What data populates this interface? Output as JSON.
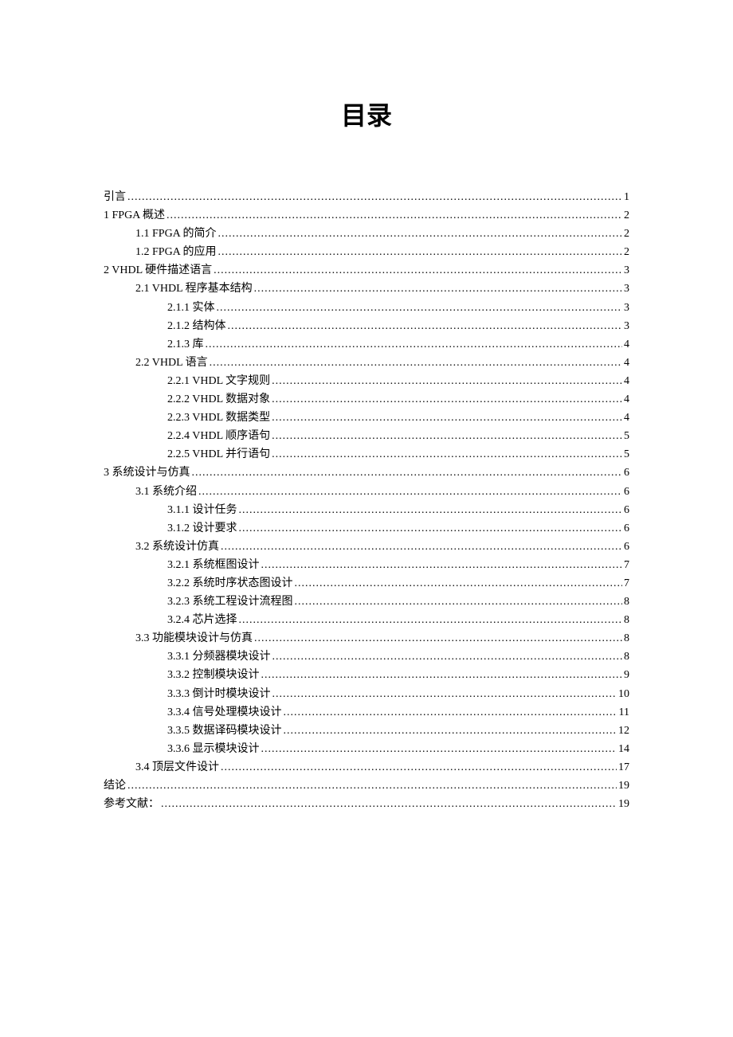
{
  "title": "目录",
  "toc": [
    {
      "level": 0,
      "label": "引言",
      "page": "1"
    },
    {
      "level": 0,
      "label": "1 FPGA 概述",
      "page": "2"
    },
    {
      "level": 1,
      "label": "1.1 FPGA 的简介",
      "page": "2"
    },
    {
      "level": 1,
      "label": "1.2 FPGA 的应用",
      "page": "2"
    },
    {
      "level": 0,
      "label": "2 VHDL 硬件描述语言",
      "page": "3"
    },
    {
      "level": 1,
      "label": "2.1 VHDL 程序基本结构",
      "page": "3"
    },
    {
      "level": 2,
      "label": "2.1.1 实体",
      "page": "3"
    },
    {
      "level": 2,
      "label": "2.1.2 结构体",
      "page": "3"
    },
    {
      "level": 2,
      "label": "2.1.3 库",
      "page": "4"
    },
    {
      "level": 1,
      "label": "2.2 VHDL 语言",
      "page": "4"
    },
    {
      "level": 2,
      "label": "2.2.1 VHDL 文字规则",
      "page": "4"
    },
    {
      "level": 2,
      "label": "2.2.2 VHDL 数据对象",
      "page": "4"
    },
    {
      "level": 2,
      "label": "2.2.3 VHDL 数据类型",
      "page": "4"
    },
    {
      "level": 2,
      "label": "2.2.4 VHDL 顺序语句",
      "page": "5"
    },
    {
      "level": 2,
      "label": "2.2.5 VHDL 并行语句",
      "page": "5"
    },
    {
      "level": 0,
      "label": "3 系统设计与仿真",
      "page": "6"
    },
    {
      "level": 1,
      "label": "3.1 系统介绍",
      "page": "6"
    },
    {
      "level": 2,
      "label": "3.1.1 设计任务",
      "page": "6"
    },
    {
      "level": 2,
      "label": "3.1.2 设计要求",
      "page": "6"
    },
    {
      "level": 1,
      "label": "3.2 系统设计仿真",
      "page": "6"
    },
    {
      "level": 2,
      "label": "3.2.1 系统框图设计",
      "page": "7"
    },
    {
      "level": 2,
      "label": "3.2.2 系统时序状态图设计",
      "page": "7"
    },
    {
      "level": 2,
      "label": "3.2.3 系统工程设计流程图",
      "page": "8"
    },
    {
      "level": 2,
      "label": "3.2.4 芯片选择",
      "page": "8"
    },
    {
      "level": 1,
      "label": "3.3 功能模块设计与仿真",
      "page": "8"
    },
    {
      "level": 2,
      "label": "3.3.1 分频器模块设计",
      "page": "8"
    },
    {
      "level": 2,
      "label": "3.3.2 控制模块设计",
      "page": "9"
    },
    {
      "level": 2,
      "label": "3.3.3 倒计时模块设计",
      "page": "10"
    },
    {
      "level": 2,
      "label": "3.3.4 信号处理模块设计",
      "page": "11"
    },
    {
      "level": 2,
      "label": "3.3.5 数据译码模块设计",
      "page": "12"
    },
    {
      "level": 2,
      "label": "3.3.6 显示模块设计",
      "page": "14"
    },
    {
      "level": 1,
      "label": "3.4 顶层文件设计",
      "page": "17"
    },
    {
      "level": 0,
      "label": "结论",
      "page": "19"
    },
    {
      "level": 0,
      "label": "参考文献：",
      "page": "19"
    }
  ]
}
